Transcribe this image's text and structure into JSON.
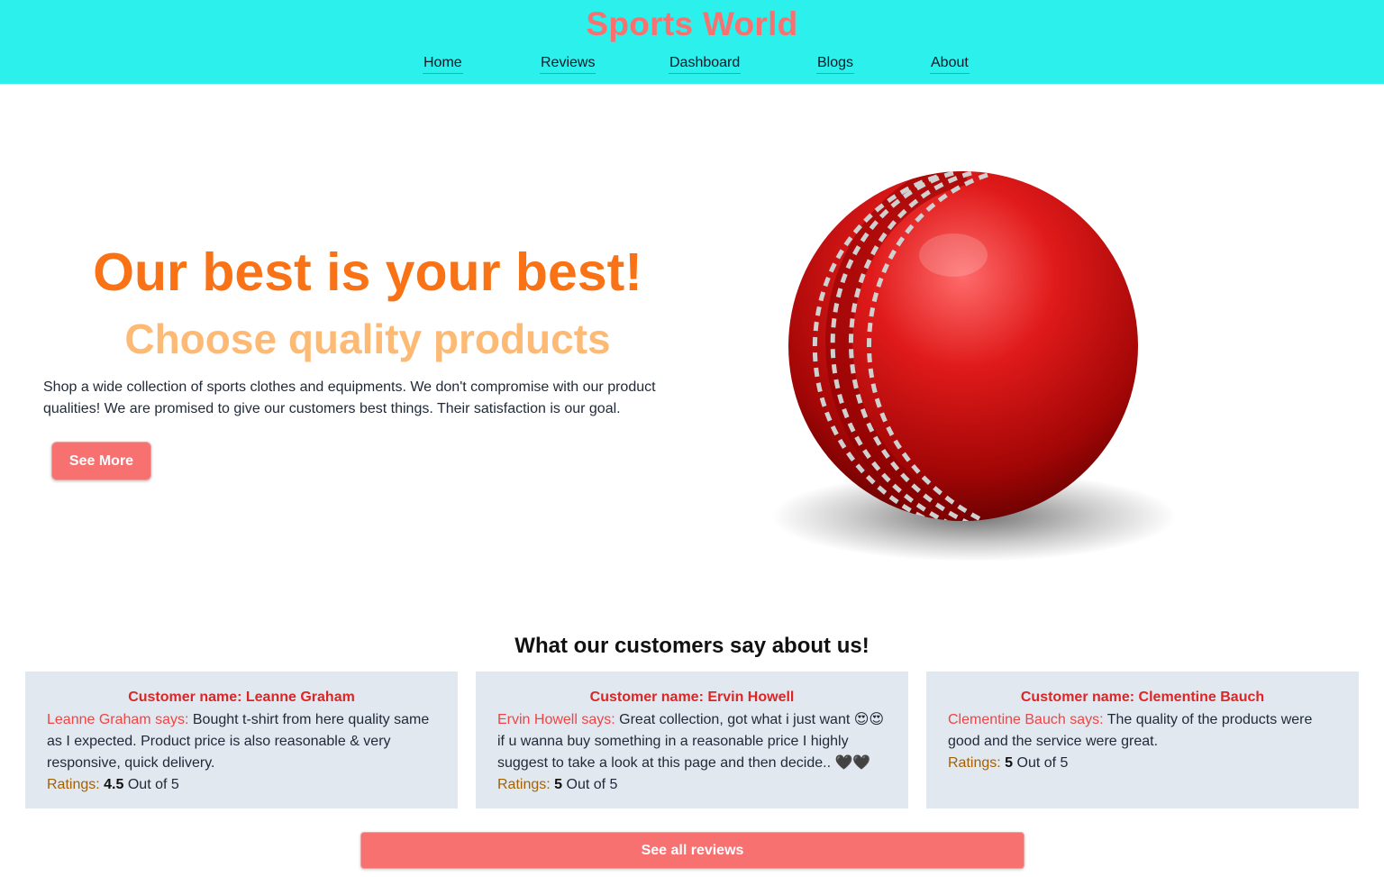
{
  "header": {
    "brand": "Sports World",
    "nav": [
      "Home",
      "Reviews",
      "Dashboard",
      "Blogs",
      "About"
    ]
  },
  "hero": {
    "title": "Our best is your best!",
    "subtitle": "Choose quality products",
    "text": "Shop a wide collection of sports clothes and equipments. We don't compromise with our product qualities! We are promised to give our customers best things. Their satisfaction is our goal.",
    "button": "See More",
    "image": "cricket-ball"
  },
  "reviews": {
    "title": "What our customers say about us!",
    "cards": [
      {
        "name": "Customer name: Leanne Graham",
        "says": "Leanne Graham says:",
        "text": "Bought t-shirt from here quality same as I expected. Product price is also reasonable & very responsive, quick delivery.",
        "rating_label": "Ratings:",
        "rating": "4.5",
        "rating_suffix": "Out of 5"
      },
      {
        "name": "Customer name: Ervin Howell",
        "says": "Ervin Howell says:",
        "text": "Great collection, got what i just want 😍😍 if u wanna buy something in a reasonable price I highly suggest to take a look at this page and then decide.. 🖤🖤",
        "rating_label": "Ratings:",
        "rating": "5",
        "rating_suffix": "Out of 5"
      },
      {
        "name": "Customer name: Clementine Bauch",
        "says": "Clementine Bauch says:",
        "text": "The quality of the products were good and the service were great.",
        "rating_label": "Ratings:",
        "rating": "5",
        "rating_suffix": "Out of 5"
      }
    ],
    "button": "See all reviews"
  },
  "colors": {
    "header_bg": "#2bf0ec",
    "brand": "#f87171",
    "hero_title": "#f97316",
    "hero_subtitle": "#fdba74",
    "button": "#f87171",
    "card_bg": "#e2e8f0",
    "name": "#dc2626",
    "rating_label": "#a16207"
  }
}
